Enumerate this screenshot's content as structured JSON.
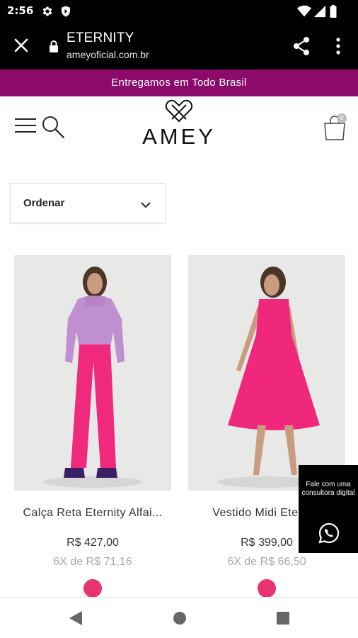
{
  "status_bar": {
    "time": "2:56",
    "icons": [
      "gear-icon",
      "shield-icon",
      "wifi-icon",
      "signal-icon",
      "battery-icon"
    ]
  },
  "toolbar": {
    "title": "ETERNITY",
    "url": "ameyoficial.com.br",
    "icons": [
      "close-icon",
      "lock-icon",
      "share-icon",
      "more-vert-icon"
    ]
  },
  "promo_banner": {
    "text": "Entregamos em Todo Brasil",
    "color": "#8b0a6a"
  },
  "header": {
    "logo_text": "AMEY",
    "cart_count": "0",
    "icons": [
      "menu-icon",
      "search-icon",
      "shopping-bag-icon"
    ]
  },
  "sort": {
    "label": "Ordenar",
    "icon": "chevron-down-icon"
  },
  "products": [
    {
      "name": "Calça Reta Eternity Alfai...",
      "price": "R$ 427,00",
      "installments": "6X de R$ 71,16",
      "swatch_color": "#e8336f"
    },
    {
      "name": "Vestido Midi Eternity",
      "price": "R$ 399,00",
      "installments": "6X de R$ 66,50",
      "swatch_color": "#e8336f"
    }
  ],
  "whatsapp": {
    "text": "Fale com uma consultora digital",
    "icon": "whatsapp-icon"
  },
  "nav_bar": {
    "icons": [
      "back-icon",
      "home-icon",
      "recents-icon"
    ]
  }
}
